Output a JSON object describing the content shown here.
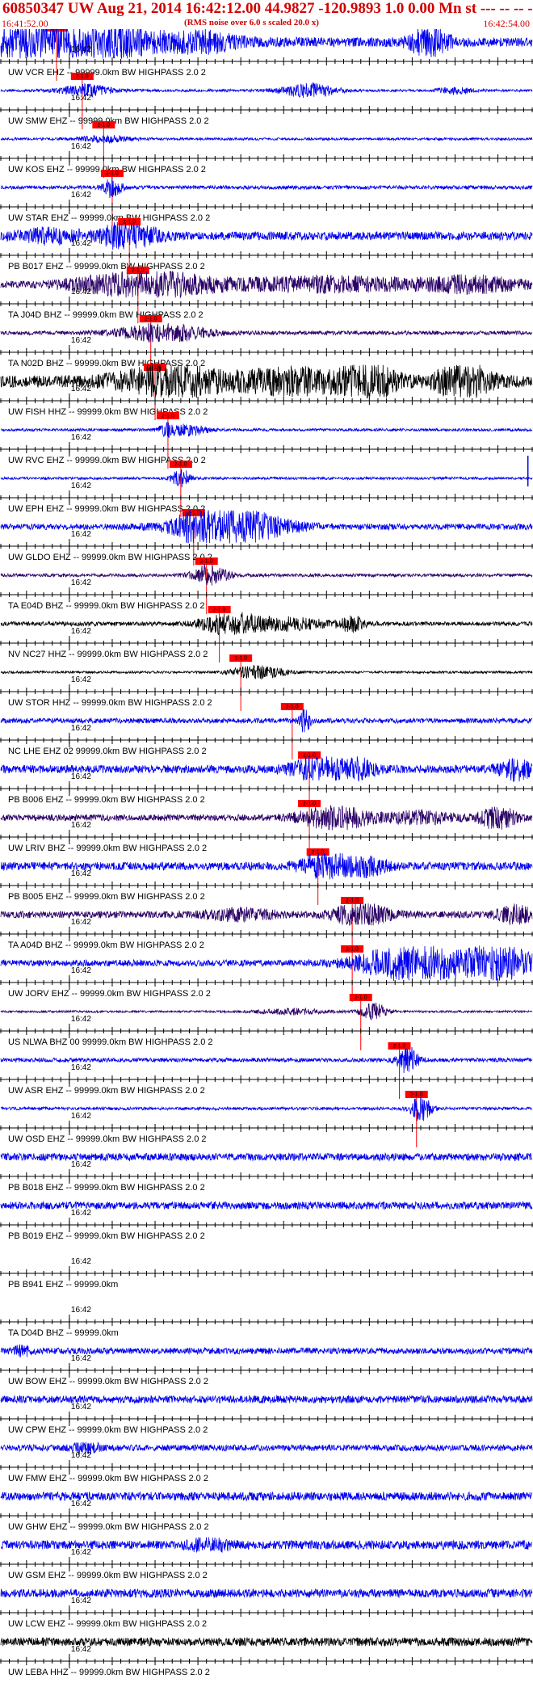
{
  "header": {
    "title": "60850347 UW Aug 21, 2014 16:42:12.00   44.9827 -120.9893  1.0 0.00 Mn st --- -- --   -1",
    "start_time": "16:41:52.00",
    "subtitle": "(RMS noise over 6.0 s scaled 20.0 x)",
    "end_time": "16:42:54.00"
  },
  "colors": {
    "title": "#d00000",
    "trace_blue": "#0000ee",
    "trace_black": "#000000",
    "trace_purple": "#2a0066",
    "pick_box": "#ff0000",
    "pick_line": "#ff0000",
    "axis": "#000000"
  },
  "chart_data": {
    "type": "line",
    "chart_kind": "seismogram record section",
    "time_range": [
      0,
      62
    ],
    "time_unit": "s after 16:41:52.00",
    "minute_tick_label": "16:42",
    "minute_tick_time": 8,
    "pick_label": "z-1.0",
    "traces": [
      {
        "label": "UW VCR EHZ -- 99999.0km BW  HIGHPASS  2.0  2",
        "pick_time": 6.5,
        "color": "blue",
        "amp": 0.95,
        "noise": 0.28,
        "bursts": [
          [
            8,
            12,
            1.0
          ],
          [
            6,
            2,
            0.8
          ],
          [
            50,
            2,
            0.9
          ],
          [
            24,
            3,
            0.4
          ]
        ],
        "spike": null
      },
      {
        "label": "UW SMW EHZ -- 99999.0km BW  HIGHPASS  2.0  2",
        "pick_time": 9.5,
        "color": "blue",
        "amp": 0.5,
        "noise": 0.15,
        "bursts": [
          [
            10,
            3,
            0.6
          ],
          [
            36,
            3,
            0.8
          ],
          [
            53,
            2,
            0.3
          ]
        ],
        "spike": null
      },
      {
        "label": "UW KOS EHZ -- 99999.0km BW  HIGHPASS  2.0  2",
        "pick_time": 12.0,
        "color": "blue",
        "amp": 0.35,
        "noise": 0.2,
        "bursts": [
          [
            12,
            3,
            0.5
          ]
        ],
        "spike": null
      },
      {
        "label": "UW STAR EHZ -- 99999.0km BW  HIGHPASS  2.0  2",
        "pick_time": 13.0,
        "color": "blue",
        "amp": 0.6,
        "noise": 0.18,
        "bursts": [
          [
            13,
            1,
            1.0
          ]
        ],
        "spike": null
      },
      {
        "label": "PB B017 EHZ -- 99999.0km BW  HIGHPASS  2.0  2",
        "pick_time": 15.0,
        "color": "blue",
        "amp": 0.8,
        "noise": 0.3,
        "bursts": [
          [
            15,
            3,
            1.0
          ],
          [
            6,
            4,
            0.4
          ]
        ],
        "spike": null
      },
      {
        "label": "TA J04D BHZ -- 99999.0km BW  HIGHPASS  2.0  2",
        "pick_time": 16.0,
        "color": "purple",
        "amp": 0.75,
        "noise": 0.25,
        "bursts": [
          [
            17,
            8,
            0.9
          ],
          [
            38,
            10,
            0.5
          ],
          [
            55,
            6,
            0.5
          ]
        ],
        "spike": null
      },
      {
        "label": "TA N02D BHZ -- 99999.0km BW  HIGHPASS  2.0  2",
        "pick_time": 17.5,
        "color": "purple",
        "amp": 0.55,
        "noise": 0.2,
        "bursts": [
          [
            19,
            5,
            0.9
          ]
        ],
        "spike": null
      },
      {
        "label": "UW FISH HHZ -- 99999.0km BW  HIGHPASS  2.0  2",
        "pick_time": 18.0,
        "color": "black",
        "amp": 0.95,
        "noise": 0.35,
        "bursts": [
          [
            20,
            6,
            0.8
          ],
          [
            43,
            3,
            1.0
          ],
          [
            54,
            3,
            1.0
          ],
          [
            34,
            6,
            0.6
          ]
        ],
        "spike": null
      },
      {
        "label": "UW RVC EHZ -- 99999.0km BW  HIGHPASS  2.0  2",
        "pick_time": 19.5,
        "color": "blue",
        "amp": 0.5,
        "noise": 0.15,
        "bursts": [
          [
            19.5,
            1,
            0.7
          ],
          [
            22,
            2,
            0.6
          ]
        ],
        "spike": null
      },
      {
        "label": "UW EPH EHZ -- 99999.0km BW  HIGHPASS  2.0  2",
        "pick_time": 21.0,
        "color": "blue",
        "amp": 0.6,
        "noise": 0.12,
        "bursts": [
          [
            21,
            1,
            1.0
          ]
        ],
        "spike": 61.5
      },
      {
        "label": "UW GLDO EHZ -- 99999.0km BW  HIGHPASS  2.0  2",
        "pick_time": 22.5,
        "color": "blue",
        "amp": 0.95,
        "noise": 0.18,
        "bursts": [
          [
            27,
            6,
            1.0
          ],
          [
            23,
            2,
            0.7
          ]
        ],
        "spike": null
      },
      {
        "label": "TA E04D BHZ -- 99999.0km BW  HIGHPASS  2.0  2",
        "pick_time": 24.0,
        "color": "purple",
        "amp": 0.6,
        "noise": 0.15,
        "bursts": [
          [
            24.5,
            2,
            1.0
          ]
        ],
        "spike": null
      },
      {
        "label": "NV NC27 HHZ -- 99999.0km BW  HIGHPASS  2.0  2",
        "pick_time": 25.5,
        "color": "black",
        "amp": 0.65,
        "noise": 0.18,
        "bursts": [
          [
            26.5,
            3,
            1.0
          ],
          [
            33,
            5,
            0.5
          ],
          [
            41,
            1.5,
            0.6
          ]
        ],
        "spike": null
      },
      {
        "label": "UW STOR HHZ -- 99999.0km BW  HIGHPASS  2.0  2",
        "pick_time": 28.0,
        "color": "black",
        "amp": 0.45,
        "noise": 0.15,
        "bursts": [
          [
            30,
            3,
            0.8
          ]
        ],
        "spike": null
      },
      {
        "label": "NC LHE EHZ 02 99999.0km BW  HIGHPASS  2.0  2",
        "pick_time": 34.0,
        "color": "blue",
        "amp": 0.7,
        "noise": 0.2,
        "bursts": [
          [
            35.5,
            0.6,
            1.0
          ]
        ],
        "spike": null
      },
      {
        "label": "PB B006 EHZ -- 99999.0km BW  HIGHPASS  2.0  2",
        "pick_time": 36.0,
        "color": "blue",
        "amp": 0.75,
        "noise": 0.3,
        "bursts": [
          [
            37,
            3,
            0.9
          ],
          [
            42,
            2,
            0.6
          ],
          [
            60,
            2,
            0.7
          ]
        ],
        "spike": null
      },
      {
        "label": "UW LRIV BHZ -- 99999.0km BW  HIGHPASS  2.0  2",
        "pick_time": 36.0,
        "color": "purple",
        "amp": 0.7,
        "noise": 0.25,
        "bursts": [
          [
            39,
            4,
            0.9
          ],
          [
            58,
            2,
            0.9
          ],
          [
            49,
            4,
            0.4
          ]
        ],
        "spike": null
      },
      {
        "label": "PB B005 EHZ -- 99999.0km BW  HIGHPASS  2.0  2",
        "pick_time": 37.0,
        "color": "blue",
        "amp": 0.75,
        "noise": 0.3,
        "bursts": [
          [
            38,
            3,
            0.9
          ],
          [
            43,
            2,
            0.6
          ]
        ],
        "spike": null
      },
      {
        "label": "TA A04D BHZ -- 99999.0km BW  HIGHPASS  2.0  2",
        "pick_time": 41.0,
        "color": "purple",
        "amp": 0.65,
        "noise": 0.3,
        "bursts": [
          [
            42,
            3,
            1.0
          ],
          [
            60,
            2,
            0.7
          ],
          [
            28,
            4,
            0.4
          ]
        ],
        "spike": null
      },
      {
        "label": "UW JORV EHZ -- 99999.0km BW  HIGHPASS  2.0  2",
        "pick_time": 41.0,
        "color": "blue",
        "amp": 1.0,
        "noise": 0.18,
        "bursts": [
          [
            48,
            6,
            1.0
          ],
          [
            58,
            4,
            1.0
          ]
        ],
        "spike": null
      },
      {
        "label": "US NLWA BHZ 00 99999.0km BW  HIGHPASS  2.0  2",
        "pick_time": 42.0,
        "color": "purple",
        "amp": 0.5,
        "noise": 0.12,
        "bursts": [
          [
            43.5,
            1.5,
            1.0
          ],
          [
            34,
            4,
            0.3
          ]
        ],
        "spike": null
      },
      {
        "label": "UW ASR EHZ -- 99999.0km BW  HIGHPASS  2.0  2",
        "pick_time": 46.5,
        "color": "blue",
        "amp": 0.75,
        "noise": 0.15,
        "bursts": [
          [
            47.5,
            1.2,
            1.0
          ]
        ],
        "spike": null
      },
      {
        "label": "UW OSD EHZ -- 99999.0km BW  HIGHPASS  2.0  2",
        "pick_time": 48.5,
        "color": "blue",
        "amp": 0.7,
        "noise": 0.12,
        "bursts": [
          [
            49,
            1.2,
            1.0
          ]
        ],
        "spike": null
      },
      {
        "label": "PB B018 EHZ -- 99999.0km BW  HIGHPASS  2.0  2",
        "pick_time": null,
        "color": "blue",
        "amp": 0.3,
        "noise": 0.7,
        "bursts": [],
        "spike": null
      },
      {
        "label": "PB B019 EHZ -- 99999.0km BW  HIGHPASS  2.0  2",
        "pick_time": null,
        "color": "blue",
        "amp": 0.3,
        "noise": 0.7,
        "bursts": [],
        "spike": null
      },
      {
        "label": "PB B941 EHZ -- 99999.0km",
        "pick_time": null,
        "color": "blue",
        "amp": 0.0,
        "noise": 0.0,
        "bursts": [],
        "spike": null
      },
      {
        "label": "TA D04D BHZ -- 99999.0km",
        "pick_time": null,
        "color": "blue",
        "amp": 0.0,
        "noise": 0.0,
        "bursts": [],
        "spike": null
      },
      {
        "label": "UW BOW EHZ -- 99999.0km BW  HIGHPASS  2.0  2",
        "pick_time": null,
        "color": "blue",
        "amp": 0.35,
        "noise": 0.5,
        "bursts": [
          [
            2.5,
            1,
            0.7
          ]
        ],
        "spike": null
      },
      {
        "label": "UW CPW EHZ -- 99999.0km BW  HIGHPASS  2.0  2",
        "pick_time": null,
        "color": "blue",
        "amp": 0.35,
        "noise": 0.6,
        "bursts": [],
        "spike": null
      },
      {
        "label": "UW FMW EHZ -- 99999.0km BW  HIGHPASS  2.0  2",
        "pick_time": null,
        "color": "blue",
        "amp": 0.35,
        "noise": 0.5,
        "bursts": [
          [
            10,
            1.5,
            0.8
          ]
        ],
        "spike": null
      },
      {
        "label": "UW GHW EHZ -- 99999.0km BW  HIGHPASS  2.0  2",
        "pick_time": null,
        "color": "blue",
        "amp": 0.4,
        "noise": 0.6,
        "bursts": [],
        "spike": null
      },
      {
        "label": "UW GSM EHZ -- 99999.0km BW  HIGHPASS  2.0  2",
        "pick_time": null,
        "color": "blue",
        "amp": 0.45,
        "noise": 0.55,
        "bursts": [
          [
            24,
            2,
            0.9
          ]
        ],
        "spike": null
      },
      {
        "label": "UW LCW EHZ -- 99999.0km BW  HIGHPASS  2.0  2",
        "pick_time": null,
        "color": "blue",
        "amp": 0.4,
        "noise": 0.6,
        "bursts": [],
        "spike": null
      },
      {
        "label": "UW LEBA HHZ -- 99999.0km BW  HIGHPASS  2.0  2",
        "pick_time": null,
        "color": "black",
        "amp": 0.4,
        "noise": 0.6,
        "bursts": [],
        "spike": null
      }
    ]
  }
}
